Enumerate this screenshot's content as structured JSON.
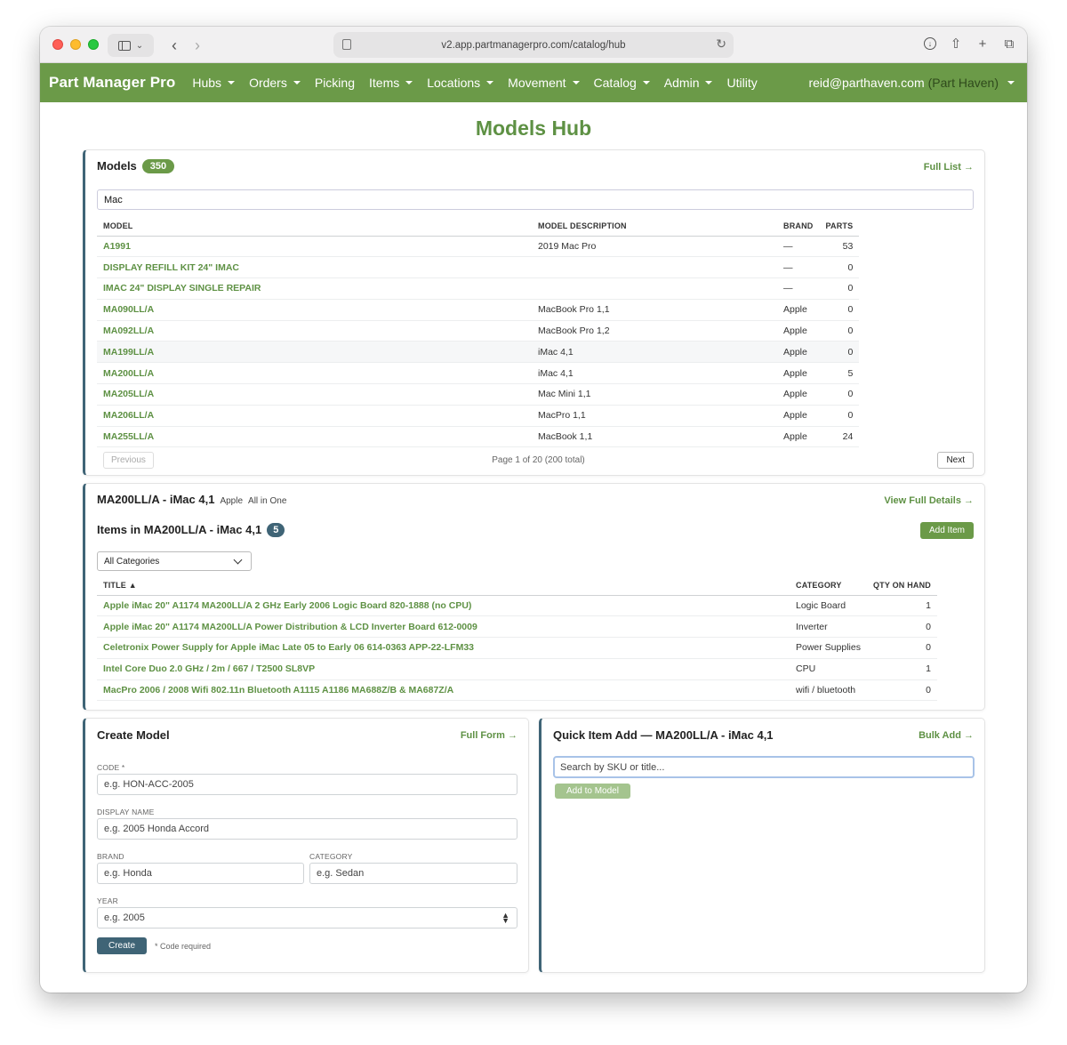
{
  "browser": {
    "url": "v2.app.partmanagerpro.com/catalog/hub"
  },
  "navbar": {
    "brand": "Part Manager Pro",
    "items": [
      {
        "label": "Hubs",
        "dropdown": true
      },
      {
        "label": "Orders",
        "dropdown": true
      },
      {
        "label": "Picking",
        "dropdown": false
      },
      {
        "label": "Items",
        "dropdown": true
      },
      {
        "label": "Locations",
        "dropdown": true
      },
      {
        "label": "Movement",
        "dropdown": true
      },
      {
        "label": "Catalog",
        "dropdown": true
      },
      {
        "label": "Admin",
        "dropdown": true
      },
      {
        "label": "Utility",
        "dropdown": false
      }
    ],
    "user_email": "reid@parthaven.com",
    "tenant": "(Part Haven)"
  },
  "page_title": "Models Hub",
  "models_card": {
    "title": "Models",
    "count": "350",
    "full_list_link": "Full List →",
    "filter_value": "Mac",
    "columns": [
      "MODEL",
      "MODEL DESCRIPTION",
      "BRAND",
      "PARTS"
    ],
    "rows": [
      {
        "model": "A1991",
        "description": "2019 Mac Pro",
        "brand": "—",
        "parts": "53"
      },
      {
        "model": "DISPLAY REFILL KIT 24\" IMAC",
        "description": "",
        "brand": "—",
        "parts": "0"
      },
      {
        "model": "IMAC 24\" DISPLAY SINGLE REPAIR",
        "description": "",
        "brand": "—",
        "parts": "0"
      },
      {
        "model": "MA090LL/A",
        "description": "MacBook Pro 1,1",
        "brand": "Apple",
        "parts": "0"
      },
      {
        "model": "MA092LL/A",
        "description": "MacBook Pro 1,2",
        "brand": "Apple",
        "parts": "0"
      },
      {
        "model": "MA199LL/A",
        "description": "iMac 4,1",
        "brand": "Apple",
        "parts": "0"
      },
      {
        "model": "MA200LL/A",
        "description": "iMac 4,1",
        "brand": "Apple",
        "parts": "5"
      },
      {
        "model": "MA205LL/A",
        "description": "Mac Mini 1,1",
        "brand": "Apple",
        "parts": "0"
      },
      {
        "model": "MA206LL/A",
        "description": "MacPro 1,1",
        "brand": "Apple",
        "parts": "0"
      },
      {
        "model": "MA255LL/A",
        "description": "MacBook 1,1",
        "brand": "Apple",
        "parts": "24"
      }
    ],
    "pager": {
      "previous": "Previous",
      "info": "Page 1 of 20 (200 total)",
      "next": "Next"
    }
  },
  "detail_card": {
    "title": "MA200LL/A - iMac 4,1",
    "brand": "Apple",
    "type": "All in One",
    "view_details_link": "View Full Details →",
    "items_title": "Items in MA200LL/A - iMac 4,1",
    "items_count": "5",
    "add_item_label": "Add Item",
    "category_select": "All Categories",
    "columns": [
      "TITLE ▲",
      "CATEGORY",
      "QTY ON HAND"
    ],
    "rows": [
      {
        "title": "Apple iMac 20\" A1174 MA200LL/A 2 GHz Early 2006 Logic Board 820-1888 (no CPU)",
        "category": "Logic Board",
        "qty": "1"
      },
      {
        "title": "Apple iMac 20\" A1174 MA200LL/A Power Distribution & LCD Inverter Board 612-0009",
        "category": "Inverter",
        "qty": "0"
      },
      {
        "title": "Celetronix Power Supply for Apple iMac Late 05 to Early 06 614-0363 APP-22-LFM33",
        "category": "Power Supplies",
        "qty": "0"
      },
      {
        "title": "Intel Core Duo 2.0 GHz / 2m / 667 / T2500 SL8VP",
        "category": "CPU",
        "qty": "1"
      },
      {
        "title": "MacPro 2006 / 2008 Wifi 802.11n Bluetooth A1115 A1186 MA688Z/B & MA687Z/A",
        "category": "wifi / bluetooth",
        "qty": "0"
      }
    ]
  },
  "create_model": {
    "title": "Create Model",
    "full_form_link": "Full Form →",
    "code_label": "CODE *",
    "code_placeholder": "e.g. HON-ACC-2005",
    "display_name_label": "DISPLAY NAME",
    "display_name_placeholder": "e.g. 2005 Honda Accord",
    "brand_label": "BRAND",
    "brand_placeholder": "e.g. Honda",
    "category_label": "CATEGORY",
    "category_placeholder": "e.g. Sedan",
    "year_label": "YEAR",
    "year_placeholder": "e.g. 2005",
    "create_button": "Create",
    "note": "* Code required"
  },
  "quick_add": {
    "title": "Quick Item Add — MA200LL/A - iMac 4,1",
    "bulk_add_link": "Bulk Add →",
    "search_placeholder": "Search by SKU or title...",
    "add_button": "Add to Model"
  },
  "colors": {
    "brand_green": "#6b9a48",
    "link_green": "#5e9144",
    "accent_slate": "#3f6476"
  }
}
